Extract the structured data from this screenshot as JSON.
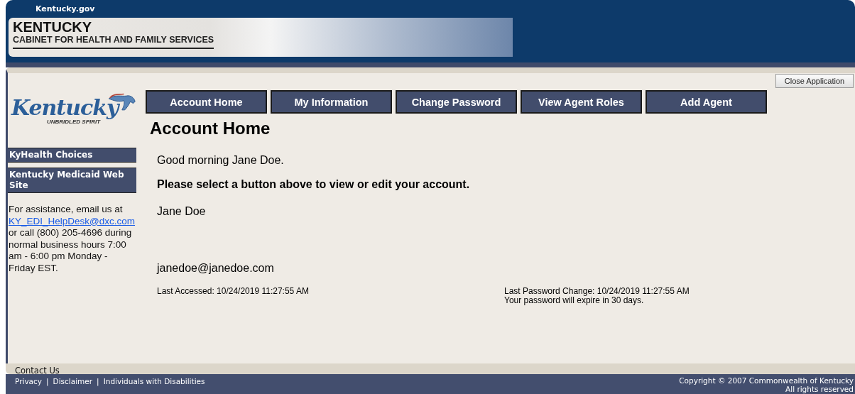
{
  "header": {
    "portal": "Kentucky.gov",
    "state": "KENTUCKY",
    "agency": "CABINET FOR HEALTH AND FAMILY SERVICES"
  },
  "close_button": "Close Application",
  "logo": {
    "name": "Kentucky",
    "tagline": "UNBRIDLED SPIRIT"
  },
  "tabs": [
    {
      "label": "Account Home"
    },
    {
      "label": "My Information"
    },
    {
      "label": "Change Password"
    },
    {
      "label": "View Agent Roles"
    },
    {
      "label": "Add Agent"
    }
  ],
  "sidebar": {
    "links": [
      "KyHealth Choices",
      "Kentucky Medicaid Web Site"
    ],
    "assistance": {
      "before": "For assistance, email us at",
      "email": "KY_EDI_HelpDesk@dxc.com",
      "after": "or call (800) 205-4696 during normal business hours 7:00 am - 6:00 pm Monday - Friday EST."
    }
  },
  "page_title": "Account Home",
  "greeting": "Good morning Jane Doe.",
  "instruction": "Please select a button above to view or edit your account.",
  "user_name": "Jane Doe",
  "user_email": "janedoe@janedoe.com",
  "last_accessed": "Last Accessed: 10/24/2019 11:27:55 AM",
  "password_change": "Last Password Change: 10/24/2019 11:27:55 AM",
  "password_expiry": "Your password will expire in 30 days.",
  "contact": "Contact Us",
  "footer_links": [
    "Privacy",
    "Disclaimer",
    "Individuals with Disabilities"
  ],
  "footer_separators": [
    "|",
    "|"
  ],
  "copyright": [
    "Copyright © 2007 Commonwealth of Kentucky",
    "All rights reserved"
  ]
}
